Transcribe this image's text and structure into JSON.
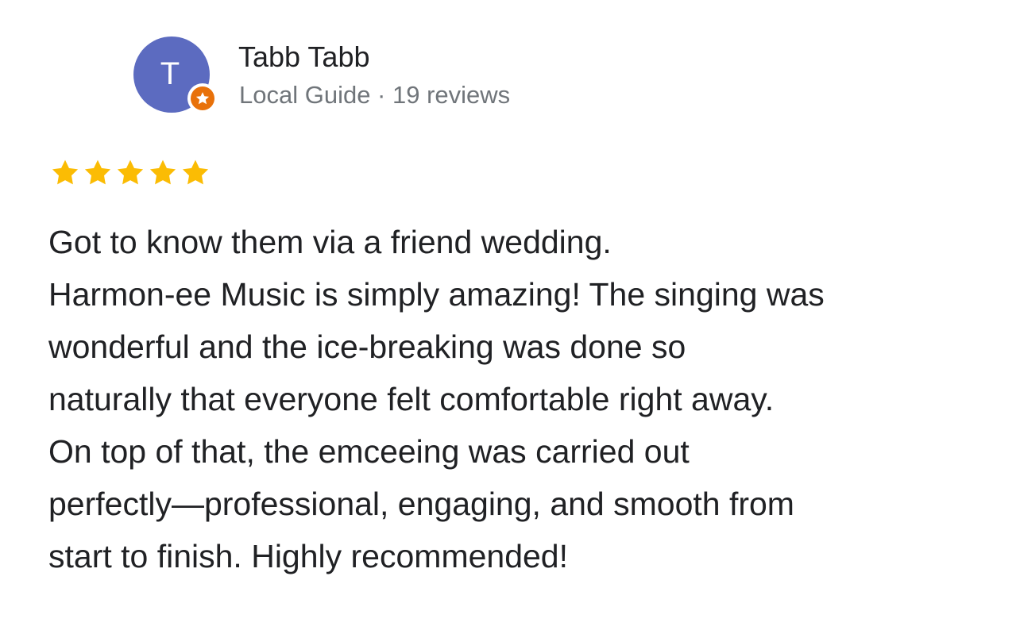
{
  "reviewer": {
    "initial": "T",
    "name": "Tabb Tabb",
    "meta": "Local Guide · 19 reviews",
    "avatar_color": "#5c6bc0",
    "badge_color": "#e8710a",
    "badge_icon": "local-guide-star-icon"
  },
  "rating": {
    "stars": 5,
    "max": 5,
    "star_color": "#fbbc04"
  },
  "review": {
    "lines": [
      "Got to know them via a friend wedding.",
      "Harmon-ee Music is simply amazing! The singing was",
      "wonderful and the ice-breaking was done so",
      "naturally that everyone felt comfortable right away.",
      "On top of that, the emceeing was carried out",
      "perfectly—professional, engaging, and smooth from",
      "start to finish. Highly recommended!"
    ]
  }
}
